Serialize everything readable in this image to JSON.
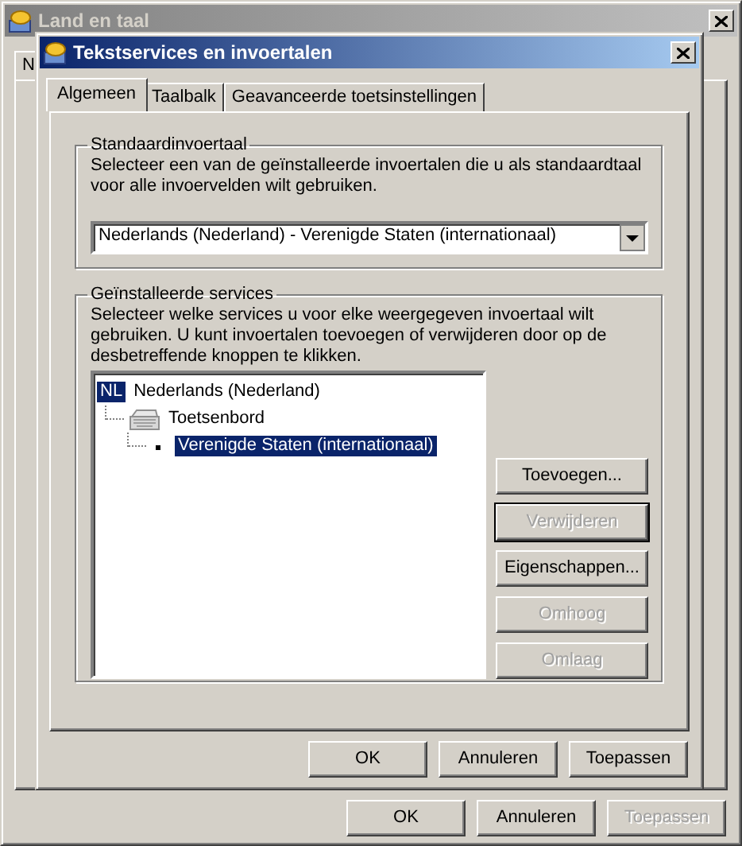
{
  "back_window": {
    "title": "Land en taal",
    "active": false,
    "tabs": [
      {
        "label": "N"
      }
    ],
    "buttons": [
      {
        "label": "OK",
        "disabled": false
      },
      {
        "label": "Annuleren",
        "disabled": false
      },
      {
        "label": "Toepassen",
        "disabled": true
      }
    ]
  },
  "dialog": {
    "title": "Tekstservices en invoertalen",
    "active": true,
    "tabs": [
      {
        "label": "Algemeen",
        "selected": true
      },
      {
        "label": "Taalbalk",
        "selected": false
      },
      {
        "label": "Geavanceerde toetsinstellingen",
        "selected": false
      }
    ],
    "default_input": {
      "title": "Standaardinvoertaal",
      "description": "Selecteer een van de geïnstalleerde invoertalen die u als standaardtaal voor alle invoervelden wilt gebruiken.",
      "value": "Nederlands (Nederland) - Verenigde Staten (internationaal)"
    },
    "services": {
      "title": "Geïnstalleerde services",
      "description": "Selecteer welke services u voor elke weergegeven invoertaal wilt gebruiken. U kunt invoertalen toevoegen of verwijderen door op de desbetreffende knoppen te klikken.",
      "tree": [
        {
          "kind": "language",
          "badge": "NL",
          "label": "Nederlands (Nederland)",
          "selected": false,
          "children": [
            {
              "kind": "category",
              "label": "Toetsenbord",
              "selected": false,
              "children": [
                {
                  "kind": "layout",
                  "label": "Verenigde Staten (internationaal)",
                  "selected": true
                }
              ]
            }
          ]
        }
      ],
      "buttons": [
        {
          "label": "Toevoegen...",
          "disabled": false,
          "default": false
        },
        {
          "label": "Verwijderen",
          "disabled": true,
          "default": true
        },
        {
          "label": "Eigenschappen...",
          "disabled": false,
          "default": false
        },
        {
          "label": "Omhoog",
          "disabled": true,
          "default": false
        },
        {
          "label": "Omlaag",
          "disabled": true,
          "default": false
        }
      ]
    },
    "buttons": [
      {
        "label": "OK",
        "disabled": false
      },
      {
        "label": "Annuleren",
        "disabled": false
      },
      {
        "label": "Toepassen",
        "disabled": false
      }
    ]
  }
}
